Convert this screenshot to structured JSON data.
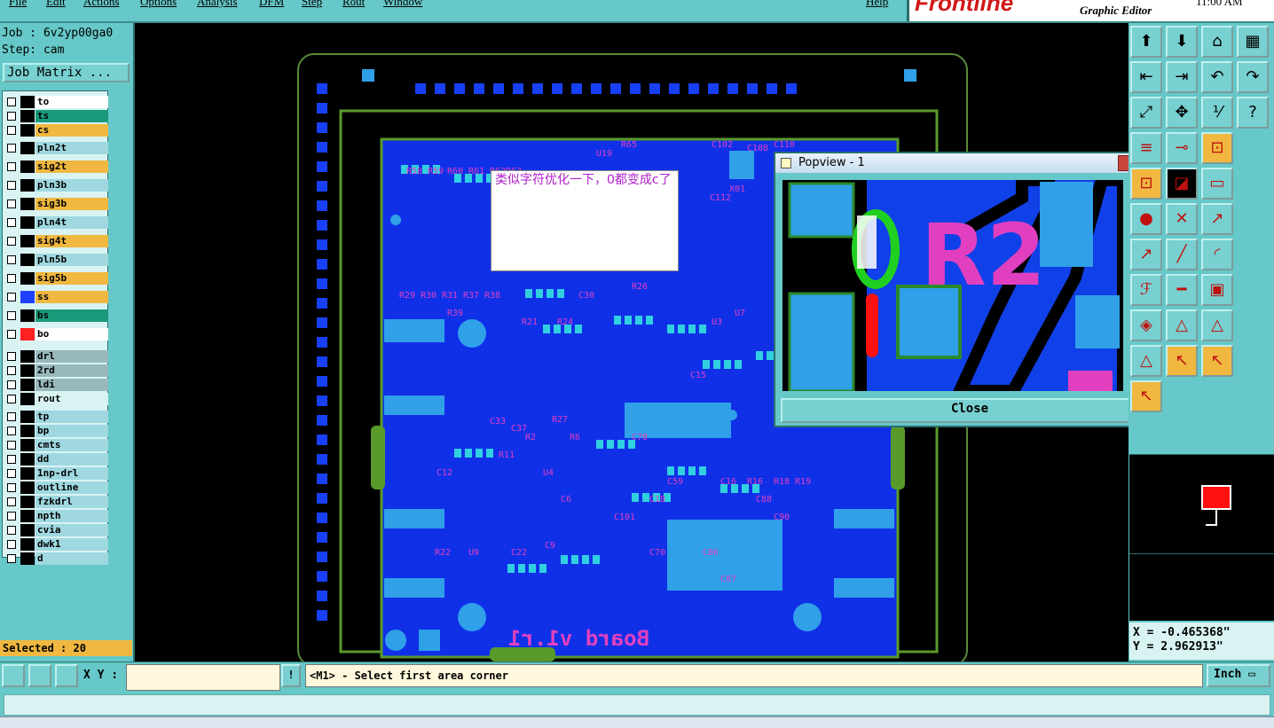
{
  "menu": [
    "File",
    "Edit",
    "Actions",
    "Options",
    "Analysis",
    "DFM",
    "Step",
    "Rout",
    "Window",
    "Help"
  ],
  "brand": {
    "logo": "Frontline",
    "subtitle": "Graphic Editor",
    "time": "11:00 AM"
  },
  "job": {
    "job_line": "Job : 6v2yp00ga0",
    "step_line": "Step: cam",
    "matrix_button": "Job Matrix ..."
  },
  "layers": [
    {
      "name": "to",
      "color": "#ffffff"
    },
    {
      "name": "ts",
      "color": "#1a9a7a"
    },
    {
      "name": "cs",
      "color": "#f0b840"
    },
    {
      "name": "pln2t",
      "color": "#9fd8e0"
    },
    {
      "name": "sig2t",
      "color": "#f0b840"
    },
    {
      "name": "pln3b",
      "color": "#9fd8e0"
    },
    {
      "name": "sig3b",
      "color": "#f0b840"
    },
    {
      "name": "pln4t",
      "color": "#9fd8e0"
    },
    {
      "name": "sig4t",
      "color": "#f0b840"
    },
    {
      "name": "pln5b",
      "color": "#9fd8e0"
    },
    {
      "name": "sig5b",
      "color": "#f0b840"
    },
    {
      "name": "ss",
      "color": "#f0b840"
    },
    {
      "name": "bs",
      "color": "#1a9a7a"
    },
    {
      "name": "bo",
      "color": "#ffffff"
    },
    {
      "name": "drl",
      "color": "#98b8bc"
    },
    {
      "name": "2rd",
      "color": "#98b8bc"
    },
    {
      "name": "ldi",
      "color": "#98b8bc"
    },
    {
      "name": "rout",
      "color": "#d9f3f3"
    },
    {
      "name": "tp",
      "color": "#9fd8e0"
    },
    {
      "name": "bp",
      "color": "#9fd8e0"
    },
    {
      "name": "cmts",
      "color": "#9fd8e0"
    },
    {
      "name": "dd",
      "color": "#9fd8e0"
    },
    {
      "name": "1np-drl",
      "color": "#9fd8e0"
    },
    {
      "name": "outline",
      "color": "#9fd8e0"
    },
    {
      "name": "fzkdrl",
      "color": "#9fd8e0"
    },
    {
      "name": "npth",
      "color": "#9fd8e0"
    },
    {
      "name": "cvia",
      "color": "#9fd8e0"
    },
    {
      "name": "dwk1",
      "color": "#9fd8e0"
    },
    {
      "name": "d",
      "color": "#9fd8e0"
    }
  ],
  "selected": "Selected : 20",
  "annotation": "类似字符优化一下，0都变成c了",
  "board": {
    "text": "Board v1.r1",
    "labels": [
      "R58",
      "R59",
      "R60",
      "R61",
      "R62",
      "R63",
      "U19",
      "R65",
      "C102",
      "C108",
      "C110",
      "C112",
      "X01",
      "R29",
      "R30",
      "R31",
      "R37",
      "R38",
      "R39",
      "R24",
      "R21",
      "C30",
      "R26",
      "U3",
      "U7",
      "C15",
      "R27",
      "C33",
      "C37",
      "R11",
      "R2",
      "R6",
      "U4",
      "C12",
      "C9",
      "C22",
      "U9",
      "R22",
      "C78",
      "C6",
      "C59",
      "C18",
      "C16",
      "R16",
      "R18",
      "R19",
      "C86",
      "C87",
      "C88",
      "C90",
      "C101",
      "C70"
    ]
  },
  "popview": {
    "title": "Popview - 1",
    "close_label": "Close",
    "close_x": "✕",
    "zoom_text": "R2"
  },
  "toolbar": {
    "icons": [
      "zoom-home-icon",
      "zoom-in-icon",
      "home-icon",
      "window-icon",
      "pan-left-icon",
      "pan-right-icon",
      "undo-icon",
      "redo-icon",
      "fit-icon",
      "center-icon",
      "scale-1-2-icon",
      "help-icon",
      "slider-icon",
      "probe-icon",
      "measure-icon",
      "measure2-icon",
      "edit-icon",
      "ruler-icon",
      "circle-icon",
      "cross-icon",
      "line-add-icon",
      "line-point-icon",
      "slash-icon",
      "arc-icon",
      "ff-icon",
      "minus-icon",
      "pad-icon",
      "pads-icon",
      "triangle-icon",
      "triangle-up-icon",
      "triangle-down-icon",
      "select-icon",
      "select2-icon",
      "select-net-icon"
    ]
  },
  "coords": {
    "x": "X = -0.465368\"",
    "y": "Y = 2.962913\""
  },
  "bottom": {
    "xy_label": "X Y :",
    "xy_value": "",
    "excl": "!",
    "message": "<M1> - Select first area corner",
    "unit": "Inch"
  }
}
